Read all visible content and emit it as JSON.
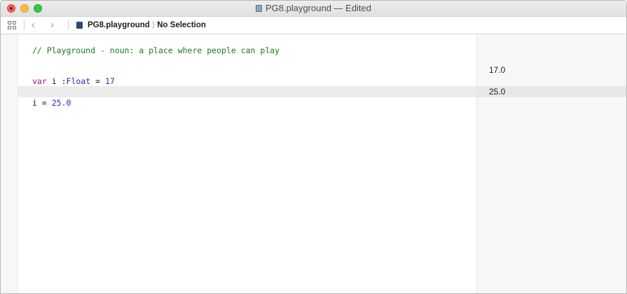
{
  "window": {
    "title": "PG8.playground — Edited"
  },
  "jumpbar": {
    "file": "PG8.playground",
    "selection": "No Selection",
    "icons": [
      "related-items-grid-icon",
      "back-chevron-icon",
      "forward-chevron-icon",
      "playground-file-icon"
    ]
  },
  "editor": {
    "comment": "// Playground - noun: a place where people can play",
    "line2": {
      "kw": "var",
      "ident": "i",
      "colon": ":",
      "type": "Float",
      "eq": "=",
      "value": "17"
    },
    "line3": {
      "ident": "i",
      "eq": "=",
      "value": "25.0"
    }
  },
  "results": {
    "line2": "17.0",
    "line3": "25.0"
  },
  "colors": {
    "comment": "#1d7a1d",
    "keyword": "#a31c93",
    "type": "#3d21b6",
    "number": "#2b27d9",
    "highlight": "#ececec"
  }
}
